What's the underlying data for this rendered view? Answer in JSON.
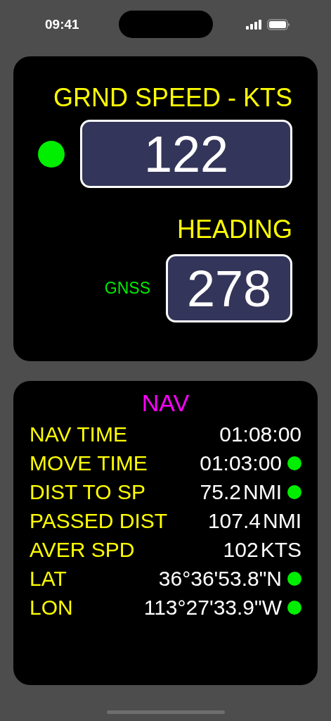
{
  "status_bar": {
    "time": "09:41"
  },
  "speed_panel": {
    "title": "GRND SPEED - KTS",
    "indicator": true,
    "speed": "122",
    "heading_title": "HEADING",
    "source": "GNSS",
    "heading": "278"
  },
  "nav_panel": {
    "title": "NAV",
    "rows": [
      {
        "label": "NAV TIME",
        "value": "01:08:00",
        "indicator": false
      },
      {
        "label": "MOVE TIME",
        "value": "01:03:00",
        "indicator": true
      },
      {
        "label": "DIST TO SP",
        "value": "75.2",
        "unit": "NMI",
        "indicator": true
      },
      {
        "label": "PASSED DIST",
        "value": "107.4",
        "unit": "NMI",
        "indicator": false
      },
      {
        "label": "AVER SPD",
        "value": "102",
        "unit": "KTS",
        "indicator": false
      },
      {
        "label": "LAT",
        "value": "36°36'53.8\"N",
        "indicator": true
      },
      {
        "label": "LON",
        "value": "113°27'33.9\"W",
        "indicator": true
      }
    ]
  }
}
